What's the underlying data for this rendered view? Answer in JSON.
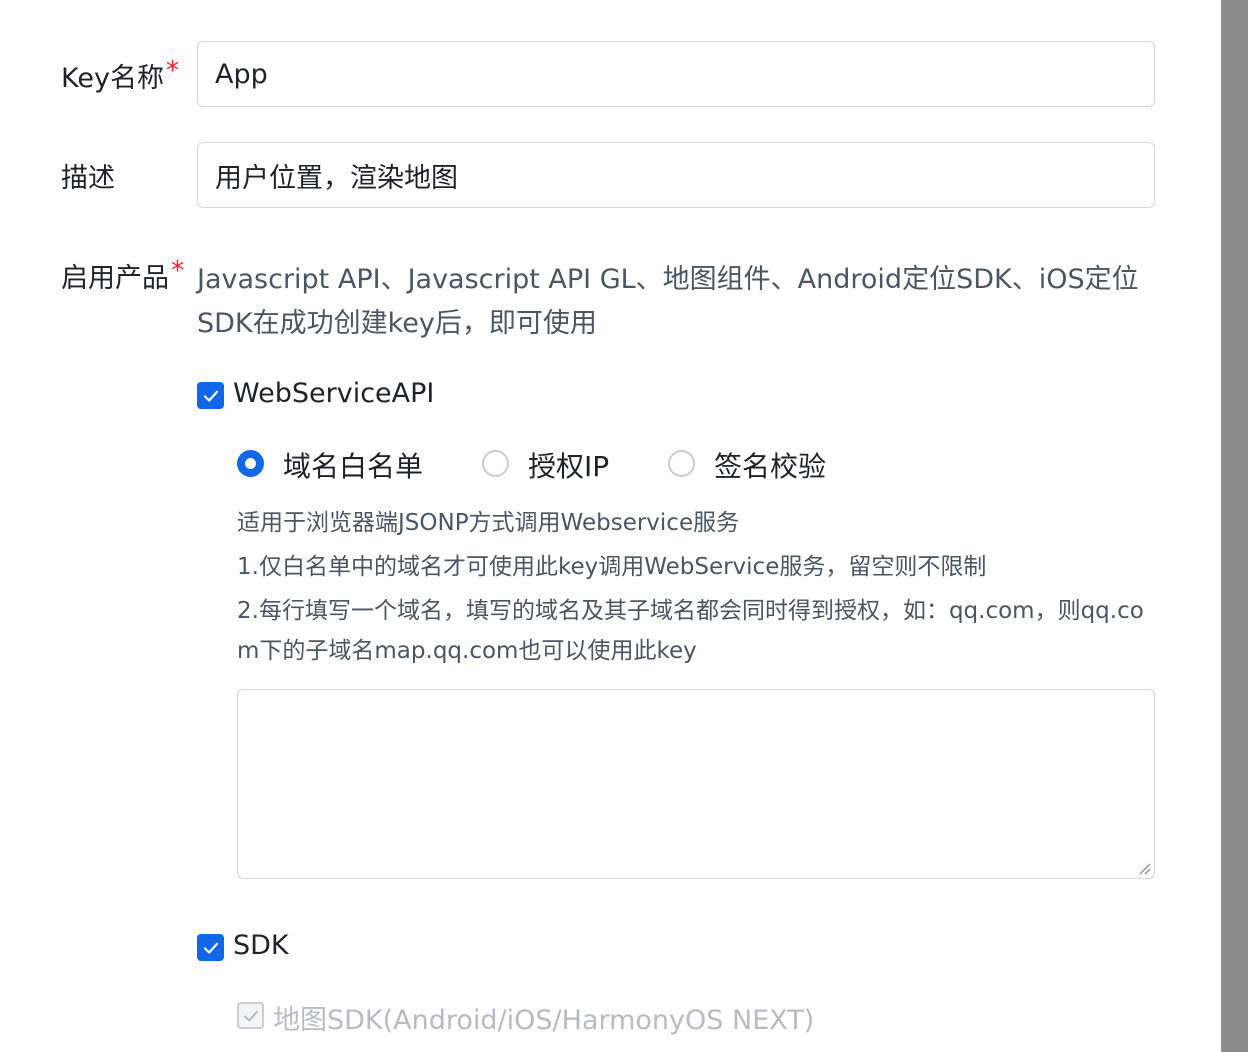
{
  "form": {
    "key_name": {
      "label": "Key名称",
      "required_mark": "*",
      "value": "App"
    },
    "description": {
      "label": "描述",
      "value": "用户位置，渲染地图"
    },
    "products": {
      "label": "启用产品",
      "required_mark": "*",
      "note": "Javascript API、Javascript API GL、地图组件、Android定位SDK、iOS定位SDK在成功创建key后，即可使用",
      "webservice": {
        "label": "WebServiceAPI",
        "checked": true,
        "auth_options": [
          {
            "label": "域名白名单",
            "selected": true
          },
          {
            "label": "授权IP",
            "selected": false
          },
          {
            "label": "签名校验",
            "selected": false
          }
        ],
        "help_lines": [
          "适用于浏览器端JSONP方式调用Webservice服务",
          "1.仅白名单中的域名才可使用此key调用WebService服务，留空则不限制",
          "2.每行填写一个域名，填写的域名及其子域名都会同时得到授权，如：qq.com，则qq.com下的子域名map.qq.com也可以使用此key"
        ],
        "domain_textarea_value": ""
      },
      "sdk": {
        "label": "SDK",
        "checked": true,
        "sub_option": {
          "label": "地图SDK(Android/iOS/HarmonyOS NEXT)",
          "checked": true,
          "disabled": true
        }
      }
    }
  },
  "colors": {
    "accent": "#1267e8",
    "required": "#f5222d",
    "border": "#d3d6dc",
    "disabled_text": "#b8bbc1"
  }
}
